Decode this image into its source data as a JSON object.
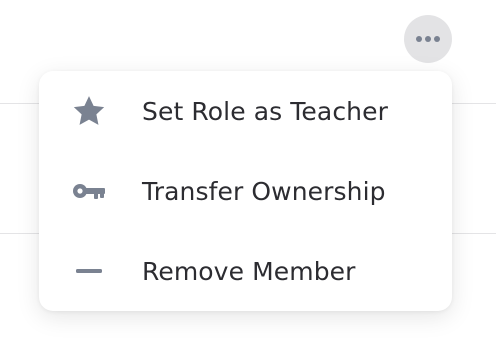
{
  "colors": {
    "icon": "#7a8291",
    "text": "#2c2c31",
    "more_button_bg": "#e3e3e5",
    "divider": "#e4e4e6"
  },
  "header": {
    "more_button_icon": "more-horizontal-icon"
  },
  "menu": {
    "items": [
      {
        "label": "Set Role as Teacher",
        "icon": "star-icon"
      },
      {
        "label": "Transfer Ownership",
        "icon": "key-icon"
      },
      {
        "label": "Remove Member",
        "icon": "minus-icon"
      }
    ]
  }
}
